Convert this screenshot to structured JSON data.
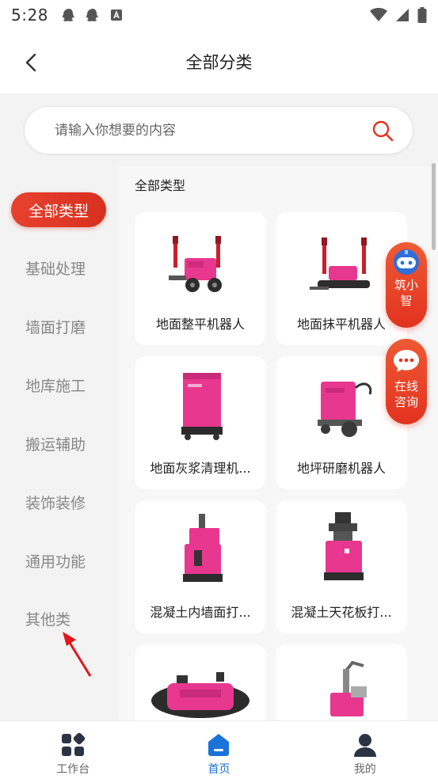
{
  "status_bar": {
    "time": "5:28"
  },
  "header": {
    "title": "全部分类"
  },
  "search": {
    "placeholder": "请输入你想要的内容"
  },
  "sidebar": {
    "items": [
      {
        "label": "全部类型",
        "active": true
      },
      {
        "label": "基础处理"
      },
      {
        "label": "墙面打磨"
      },
      {
        "label": "地库施工"
      },
      {
        "label": "搬运辅助"
      },
      {
        "label": "装饰装修"
      },
      {
        "label": "通用功能"
      },
      {
        "label": "其他类"
      }
    ]
  },
  "main": {
    "section_title": "全部类型",
    "products": [
      {
        "label": "地面整平机器人"
      },
      {
        "label": "地面抹平机器人"
      },
      {
        "label": "地面灰浆清理机..."
      },
      {
        "label": "地坪研磨机器人"
      },
      {
        "label": "混凝土内墙面打..."
      },
      {
        "label": "混凝土天花板打..."
      },
      {
        "label": ""
      },
      {
        "label": ""
      }
    ]
  },
  "floating": {
    "assistant_label": "筑小智",
    "online_label": "在线咨询",
    "assistant_line1": "筑小",
    "assistant_line2": "智",
    "online_line1": "在线",
    "online_line2": "咨询"
  },
  "bottom_nav": {
    "tabs": [
      {
        "label": "工作台",
        "icon": "grid-icon"
      },
      {
        "label": "首页",
        "icon": "home-icon",
        "active": true
      },
      {
        "label": "我的",
        "icon": "user-icon"
      }
    ]
  },
  "colors": {
    "accent": "#e2321f",
    "nav_active": "#1a73d9",
    "product": "#e8378f"
  }
}
